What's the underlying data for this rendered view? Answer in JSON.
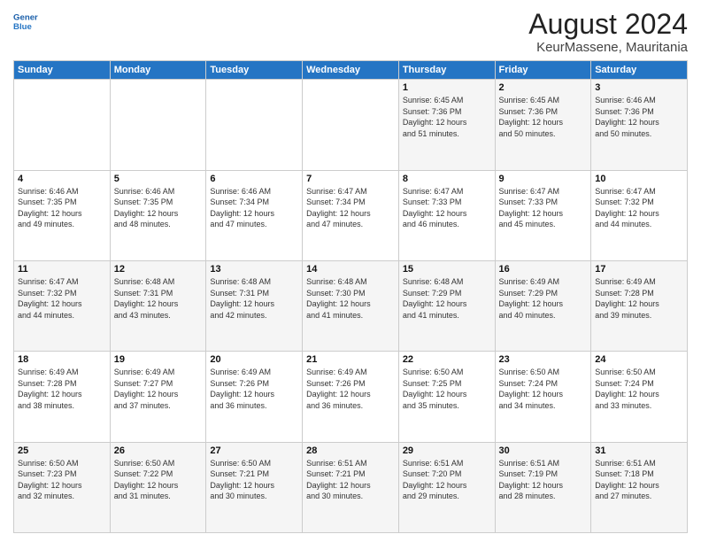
{
  "header": {
    "logo_line1": "General",
    "logo_line2": "Blue",
    "month_title": "August 2024",
    "location": "KeurMassene, Mauritania"
  },
  "weekdays": [
    "Sunday",
    "Monday",
    "Tuesday",
    "Wednesday",
    "Thursday",
    "Friday",
    "Saturday"
  ],
  "weeks": [
    [
      {
        "day": "",
        "info": ""
      },
      {
        "day": "",
        "info": ""
      },
      {
        "day": "",
        "info": ""
      },
      {
        "day": "",
        "info": ""
      },
      {
        "day": "1",
        "info": "Sunrise: 6:45 AM\nSunset: 7:36 PM\nDaylight: 12 hours\nand 51 minutes."
      },
      {
        "day": "2",
        "info": "Sunrise: 6:45 AM\nSunset: 7:36 PM\nDaylight: 12 hours\nand 50 minutes."
      },
      {
        "day": "3",
        "info": "Sunrise: 6:46 AM\nSunset: 7:36 PM\nDaylight: 12 hours\nand 50 minutes."
      }
    ],
    [
      {
        "day": "4",
        "info": "Sunrise: 6:46 AM\nSunset: 7:35 PM\nDaylight: 12 hours\nand 49 minutes."
      },
      {
        "day": "5",
        "info": "Sunrise: 6:46 AM\nSunset: 7:35 PM\nDaylight: 12 hours\nand 48 minutes."
      },
      {
        "day": "6",
        "info": "Sunrise: 6:46 AM\nSunset: 7:34 PM\nDaylight: 12 hours\nand 47 minutes."
      },
      {
        "day": "7",
        "info": "Sunrise: 6:47 AM\nSunset: 7:34 PM\nDaylight: 12 hours\nand 47 minutes."
      },
      {
        "day": "8",
        "info": "Sunrise: 6:47 AM\nSunset: 7:33 PM\nDaylight: 12 hours\nand 46 minutes."
      },
      {
        "day": "9",
        "info": "Sunrise: 6:47 AM\nSunset: 7:33 PM\nDaylight: 12 hours\nand 45 minutes."
      },
      {
        "day": "10",
        "info": "Sunrise: 6:47 AM\nSunset: 7:32 PM\nDaylight: 12 hours\nand 44 minutes."
      }
    ],
    [
      {
        "day": "11",
        "info": "Sunrise: 6:47 AM\nSunset: 7:32 PM\nDaylight: 12 hours\nand 44 minutes."
      },
      {
        "day": "12",
        "info": "Sunrise: 6:48 AM\nSunset: 7:31 PM\nDaylight: 12 hours\nand 43 minutes."
      },
      {
        "day": "13",
        "info": "Sunrise: 6:48 AM\nSunset: 7:31 PM\nDaylight: 12 hours\nand 42 minutes."
      },
      {
        "day": "14",
        "info": "Sunrise: 6:48 AM\nSunset: 7:30 PM\nDaylight: 12 hours\nand 41 minutes."
      },
      {
        "day": "15",
        "info": "Sunrise: 6:48 AM\nSunset: 7:29 PM\nDaylight: 12 hours\nand 41 minutes."
      },
      {
        "day": "16",
        "info": "Sunrise: 6:49 AM\nSunset: 7:29 PM\nDaylight: 12 hours\nand 40 minutes."
      },
      {
        "day": "17",
        "info": "Sunrise: 6:49 AM\nSunset: 7:28 PM\nDaylight: 12 hours\nand 39 minutes."
      }
    ],
    [
      {
        "day": "18",
        "info": "Sunrise: 6:49 AM\nSunset: 7:28 PM\nDaylight: 12 hours\nand 38 minutes."
      },
      {
        "day": "19",
        "info": "Sunrise: 6:49 AM\nSunset: 7:27 PM\nDaylight: 12 hours\nand 37 minutes."
      },
      {
        "day": "20",
        "info": "Sunrise: 6:49 AM\nSunset: 7:26 PM\nDaylight: 12 hours\nand 36 minutes."
      },
      {
        "day": "21",
        "info": "Sunrise: 6:49 AM\nSunset: 7:26 PM\nDaylight: 12 hours\nand 36 minutes."
      },
      {
        "day": "22",
        "info": "Sunrise: 6:50 AM\nSunset: 7:25 PM\nDaylight: 12 hours\nand 35 minutes."
      },
      {
        "day": "23",
        "info": "Sunrise: 6:50 AM\nSunset: 7:24 PM\nDaylight: 12 hours\nand 34 minutes."
      },
      {
        "day": "24",
        "info": "Sunrise: 6:50 AM\nSunset: 7:24 PM\nDaylight: 12 hours\nand 33 minutes."
      }
    ],
    [
      {
        "day": "25",
        "info": "Sunrise: 6:50 AM\nSunset: 7:23 PM\nDaylight: 12 hours\nand 32 minutes."
      },
      {
        "day": "26",
        "info": "Sunrise: 6:50 AM\nSunset: 7:22 PM\nDaylight: 12 hours\nand 31 minutes."
      },
      {
        "day": "27",
        "info": "Sunrise: 6:50 AM\nSunset: 7:21 PM\nDaylight: 12 hours\nand 30 minutes."
      },
      {
        "day": "28",
        "info": "Sunrise: 6:51 AM\nSunset: 7:21 PM\nDaylight: 12 hours\nand 30 minutes."
      },
      {
        "day": "29",
        "info": "Sunrise: 6:51 AM\nSunset: 7:20 PM\nDaylight: 12 hours\nand 29 minutes."
      },
      {
        "day": "30",
        "info": "Sunrise: 6:51 AM\nSunset: 7:19 PM\nDaylight: 12 hours\nand 28 minutes."
      },
      {
        "day": "31",
        "info": "Sunrise: 6:51 AM\nSunset: 7:18 PM\nDaylight: 12 hours\nand 27 minutes."
      }
    ]
  ]
}
